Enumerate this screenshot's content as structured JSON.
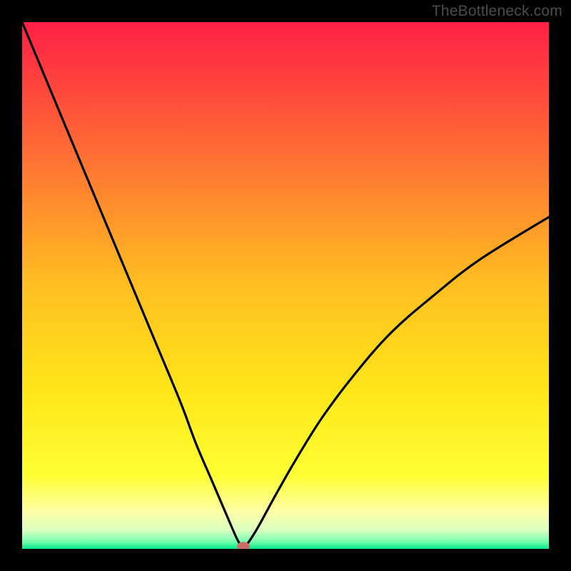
{
  "watermark": "TheBottleneck.com",
  "colors": {
    "background": "#000000",
    "watermark": "#4c4c4c",
    "curve": "#000000",
    "marker": "#cd6d69",
    "gradient_stops": [
      {
        "offset": 0.0,
        "color": "#ff1f46"
      },
      {
        "offset": 0.25,
        "color": "#ff6e34"
      },
      {
        "offset": 0.5,
        "color": "#ffbf21"
      },
      {
        "offset": 0.7,
        "color": "#ffe619"
      },
      {
        "offset": 0.86,
        "color": "#ffff33"
      },
      {
        "offset": 0.93,
        "color": "#ffffa8"
      },
      {
        "offset": 0.965,
        "color": "#d9ffc0"
      },
      {
        "offset": 0.985,
        "color": "#7dffb0"
      },
      {
        "offset": 1.0,
        "color": "#00e887"
      }
    ]
  },
  "chart_data": {
    "type": "line",
    "title": "",
    "xlabel": "",
    "ylabel": "",
    "xlim": [
      0,
      100
    ],
    "ylim": [
      0,
      100
    ],
    "grid": false,
    "legend": false,
    "annotations": [],
    "marker": {
      "x": 42.0,
      "y": 0.5
    },
    "series": [
      {
        "name": "bottleneck-curve",
        "x": [
          0,
          5,
          10,
          15,
          20,
          25,
          30,
          33,
          36,
          39,
          41,
          42,
          43,
          45,
          48,
          52,
          57,
          63,
          70,
          78,
          87,
          100
        ],
        "y": [
          100,
          88,
          76,
          64,
          52,
          40,
          28,
          20,
          13,
          6,
          1.5,
          0.5,
          1.3,
          4.5,
          10,
          17,
          25,
          33,
          41,
          48,
          55,
          63
        ]
      }
    ]
  }
}
